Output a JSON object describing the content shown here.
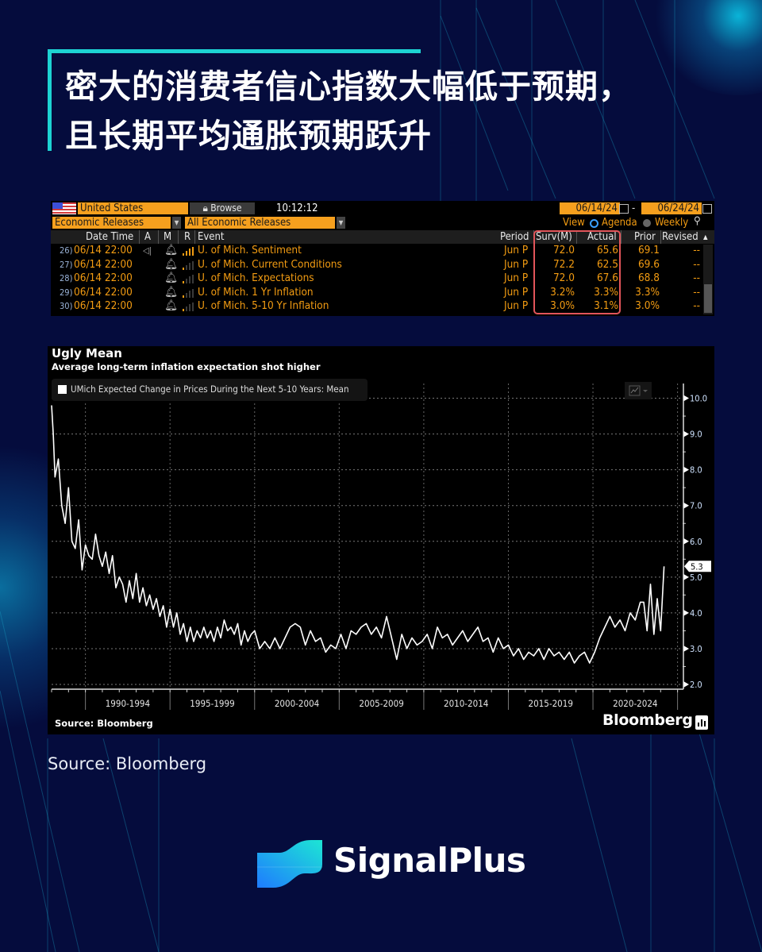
{
  "header": {
    "title_line1": "密大的消费者信心指数大幅低于预期，",
    "title_line2": "且长期平均通胀预期跃升"
  },
  "terminal": {
    "country": "United States",
    "browse_label": "Browse",
    "time": "10:12:12",
    "category": "Economic Releases",
    "filter": "All Economic Releases",
    "date_from": "06/14/24",
    "date_to": "06/24/24",
    "date_sep": "-",
    "view_label": "View",
    "view_options": [
      "Agenda",
      "Weekly"
    ],
    "view_selected": "Agenda",
    "columns": [
      "Date Time",
      "A",
      "M",
      "R",
      "Event",
      "Period",
      "Surv(M)",
      "Actual",
      "Prior",
      "Revised"
    ],
    "rows": [
      {
        "idx": "26)",
        "datetime": "06/14 22:00",
        "alert": true,
        "event": "U. of Mich. Sentiment",
        "period": "Jun P",
        "survey": "72.0",
        "actual": "65.6",
        "prior": "69.1",
        "revised": "--",
        "relevance": "high"
      },
      {
        "idx": "27)",
        "datetime": "06/14 22:00",
        "alert": false,
        "event": "U. of Mich. Current Conditions",
        "period": "Jun P",
        "survey": "72.2",
        "actual": "62.5",
        "prior": "69.6",
        "revised": "--",
        "relevance": "low"
      },
      {
        "idx": "28)",
        "datetime": "06/14 22:00",
        "alert": false,
        "event": "U. of Mich. Expectations",
        "period": "Jun P",
        "survey": "72.0",
        "actual": "67.6",
        "prior": "68.8",
        "revised": "--",
        "relevance": "low"
      },
      {
        "idx": "29)",
        "datetime": "06/14 22:00",
        "alert": false,
        "event": "U. of Mich. 1 Yr Inflation",
        "period": "Jun P",
        "survey": "3.2%",
        "actual": "3.3%",
        "prior": "3.3%",
        "revised": "--",
        "relevance": "low"
      },
      {
        "idx": "30)",
        "datetime": "06/14 22:00",
        "alert": false,
        "event": "U. of Mich. 5-10 Yr Inflation",
        "period": "Jun P",
        "survey": "3.0%",
        "actual": "3.1%",
        "prior": "3.0%",
        "revised": "--",
        "relevance": "low"
      }
    ],
    "highlight_color": "#e2555a"
  },
  "chart_data": {
    "type": "line",
    "title": "Ugly Mean",
    "subtitle": "Average long-term inflation expectation shot higher",
    "legend": [
      "UMich Expected Change in Prices During the Next 5-10 Years: Mean"
    ],
    "legend_placement": "top-left",
    "source": "Source: Bloomberg",
    "brand": "Bloomberg",
    "xlabel": "",
    "ylabel": "",
    "x_tick_labels": [
      "1990-1994",
      "1995-1999",
      "2000-2004",
      "2005-2009",
      "2010-2014",
      "2015-2019",
      "2020-2024"
    ],
    "xlim": [
      1988,
      2025.3
    ],
    "ylim": [
      2.0,
      10.3
    ],
    "y_ticks": [
      "10.0",
      "9.0",
      "8.0",
      "7.0",
      "6.0",
      "5.0",
      "4.0",
      "3.0",
      "2.0"
    ],
    "grid": true,
    "last_value_label": "5.3",
    "series": [
      {
        "name": "UMich Expected Change in Prices During the Next 5-10 Years: Mean",
        "x": [
          1988.0,
          1988.1,
          1988.2,
          1988.4,
          1988.6,
          1988.8,
          1989.0,
          1989.2,
          1989.4,
          1989.6,
          1989.8,
          1990.0,
          1990.2,
          1990.4,
          1990.6,
          1990.8,
          1991.0,
          1991.2,
          1991.4,
          1991.6,
          1991.8,
          1992.0,
          1992.2,
          1992.4,
          1992.6,
          1992.8,
          1993.0,
          1993.2,
          1993.4,
          1993.6,
          1993.8,
          1994.0,
          1994.2,
          1994.4,
          1994.6,
          1994.8,
          1995.0,
          1995.2,
          1995.4,
          1995.6,
          1995.8,
          1996.0,
          1996.2,
          1996.4,
          1996.6,
          1996.8,
          1997.0,
          1997.2,
          1997.4,
          1997.6,
          1997.8,
          1998.0,
          1998.2,
          1998.4,
          1998.6,
          1998.8,
          1999.0,
          1999.2,
          1999.4,
          1999.6,
          1999.8,
          2000.0,
          2000.3,
          2000.6,
          2000.9,
          2001.2,
          2001.5,
          2001.8,
          2002.1,
          2002.4,
          2002.7,
          2003.0,
          2003.3,
          2003.6,
          2003.9,
          2004.2,
          2004.5,
          2004.8,
          2005.1,
          2005.4,
          2005.7,
          2006.0,
          2006.3,
          2006.6,
          2006.9,
          2007.2,
          2007.5,
          2007.8,
          2008.1,
          2008.4,
          2008.7,
          2009.0,
          2009.3,
          2009.6,
          2009.9,
          2010.2,
          2010.5,
          2010.8,
          2011.1,
          2011.4,
          2011.7,
          2012.0,
          2012.3,
          2012.6,
          2012.9,
          2013.2,
          2013.5,
          2013.8,
          2014.1,
          2014.4,
          2014.7,
          2015.0,
          2015.3,
          2015.6,
          2015.9,
          2016.2,
          2016.5,
          2016.8,
          2017.1,
          2017.4,
          2017.7,
          2018.0,
          2018.3,
          2018.6,
          2018.9,
          2019.2,
          2019.5,
          2019.8,
          2020.1,
          2020.4,
          2020.7,
          2021.0,
          2021.3,
          2021.6,
          2021.9,
          2022.2,
          2022.5,
          2022.8,
          2023.0,
          2023.2,
          2023.4,
          2023.6,
          2023.8,
          2024.0,
          2024.2,
          2024.45
        ],
        "y": [
          9.8,
          9.0,
          7.8,
          8.3,
          7.0,
          6.5,
          7.5,
          6.0,
          5.8,
          6.6,
          5.2,
          5.9,
          5.6,
          5.5,
          6.2,
          5.6,
          5.3,
          5.7,
          5.1,
          5.6,
          4.7,
          5.0,
          4.8,
          4.3,
          4.9,
          4.4,
          5.1,
          4.3,
          4.7,
          4.2,
          4.5,
          4.1,
          4.4,
          3.9,
          4.2,
          3.6,
          4.1,
          3.6,
          4.0,
          3.4,
          3.7,
          3.2,
          3.6,
          3.2,
          3.5,
          3.3,
          3.6,
          3.3,
          3.5,
          3.2,
          3.6,
          3.3,
          3.8,
          3.5,
          3.6,
          3.4,
          3.7,
          3.1,
          3.5,
          3.2,
          3.4,
          3.5,
          3.0,
          3.2,
          3.0,
          3.3,
          3.0,
          3.3,
          3.6,
          3.7,
          3.6,
          3.1,
          3.5,
          3.2,
          3.3,
          2.9,
          3.1,
          3.0,
          3.4,
          3.0,
          3.5,
          3.4,
          3.6,
          3.7,
          3.4,
          3.6,
          3.3,
          3.9,
          3.3,
          2.7,
          3.4,
          3.0,
          3.3,
          3.1,
          3.2,
          3.4,
          3.0,
          3.6,
          3.3,
          3.4,
          3.1,
          3.3,
          3.5,
          3.2,
          3.4,
          3.6,
          3.2,
          3.3,
          2.9,
          3.3,
          3.0,
          3.1,
          2.8,
          3.0,
          2.7,
          2.9,
          2.8,
          3.0,
          2.7,
          3.0,
          2.8,
          2.9,
          2.7,
          2.9,
          2.6,
          2.8,
          2.9,
          2.6,
          2.9,
          3.3,
          3.6,
          3.9,
          3.6,
          3.8,
          3.5,
          4.0,
          3.8,
          4.3,
          4.3,
          3.5,
          4.8,
          3.4,
          4.4,
          3.5,
          5.3
        ]
      }
    ]
  },
  "footer": {
    "source": "Source: Bloomberg",
    "brand": "SignalPlus"
  }
}
